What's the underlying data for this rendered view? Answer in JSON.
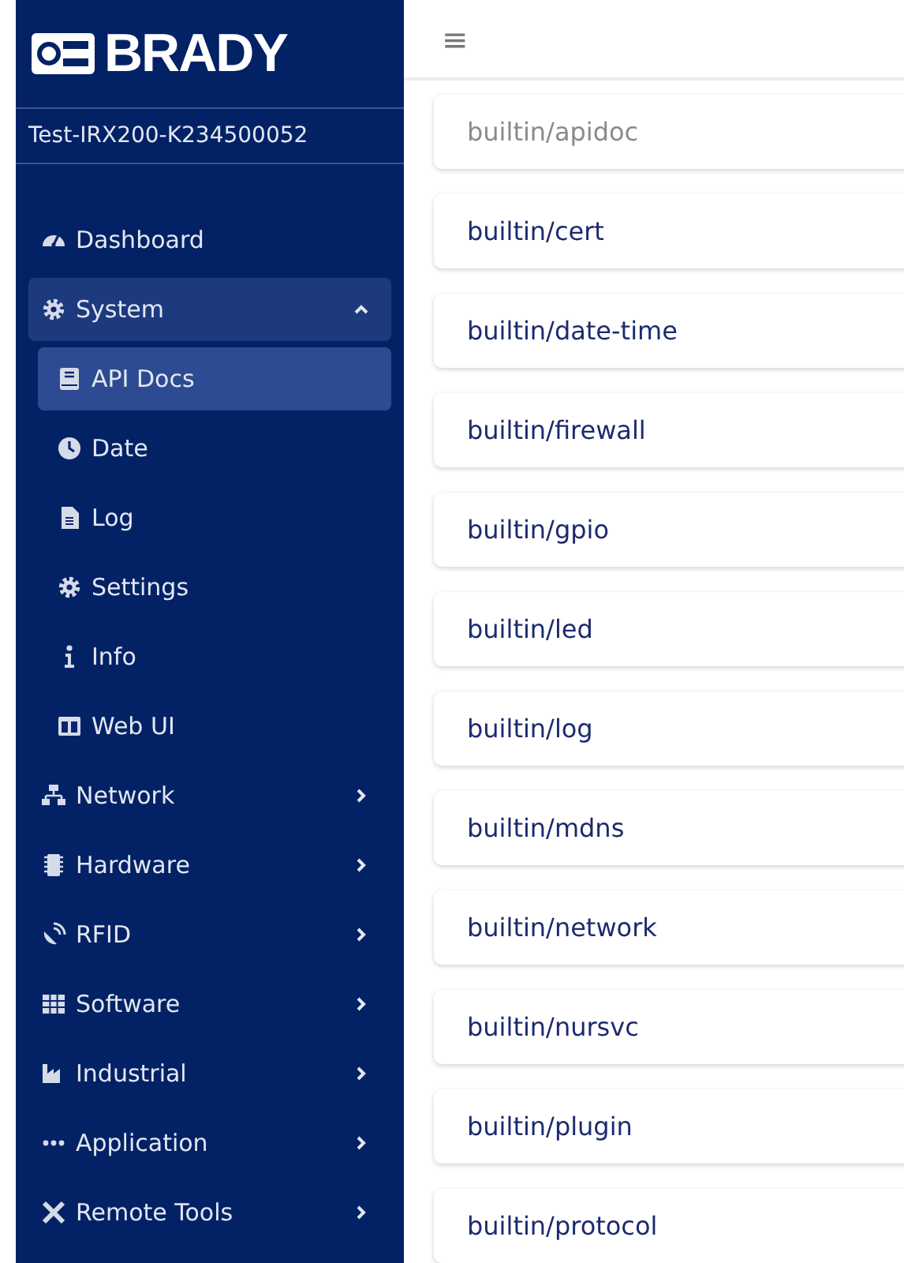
{
  "brand": {
    "logo_text": "BRADY"
  },
  "device_name": "Test-IRX200-K234500052",
  "sidebar": {
    "items": [
      {
        "label": "Dashboard",
        "kind": "link",
        "selected": false
      },
      {
        "label": "System",
        "kind": "group",
        "selected": false,
        "expanded": true,
        "children": [
          {
            "label": "API Docs",
            "selected": true
          },
          {
            "label": "Date",
            "selected": false
          },
          {
            "label": "Log",
            "selected": false
          },
          {
            "label": "Settings",
            "selected": false
          },
          {
            "label": "Info",
            "selected": false
          },
          {
            "label": "Web UI",
            "selected": false
          }
        ]
      },
      {
        "label": "Network",
        "kind": "group",
        "selected": false,
        "expanded": false
      },
      {
        "label": "Hardware",
        "kind": "group",
        "selected": false,
        "expanded": false
      },
      {
        "label": "RFID",
        "kind": "group",
        "selected": false,
        "expanded": false
      },
      {
        "label": "Software",
        "kind": "group",
        "selected": false,
        "expanded": false
      },
      {
        "label": "Industrial",
        "kind": "group",
        "selected": false,
        "expanded": false
      },
      {
        "label": "Application",
        "kind": "group",
        "selected": false,
        "expanded": false
      },
      {
        "label": "Remote Tools",
        "kind": "group",
        "selected": false,
        "expanded": false
      }
    ]
  },
  "header": {
    "menu_icon": "≡"
  },
  "api_list": [
    {
      "label": "builtin/apidoc",
      "disabled": true
    },
    {
      "label": "builtin/cert",
      "disabled": false
    },
    {
      "label": "builtin/date-time",
      "disabled": false
    },
    {
      "label": "builtin/firewall",
      "disabled": false
    },
    {
      "label": "builtin/gpio",
      "disabled": false
    },
    {
      "label": "builtin/led",
      "disabled": false
    },
    {
      "label": "builtin/log",
      "disabled": false
    },
    {
      "label": "builtin/mdns",
      "disabled": false
    },
    {
      "label": "builtin/network",
      "disabled": false
    },
    {
      "label": "builtin/nursvc",
      "disabled": false
    },
    {
      "label": "builtin/plugin",
      "disabled": false
    },
    {
      "label": "builtin/protocol",
      "disabled": false
    }
  ]
}
